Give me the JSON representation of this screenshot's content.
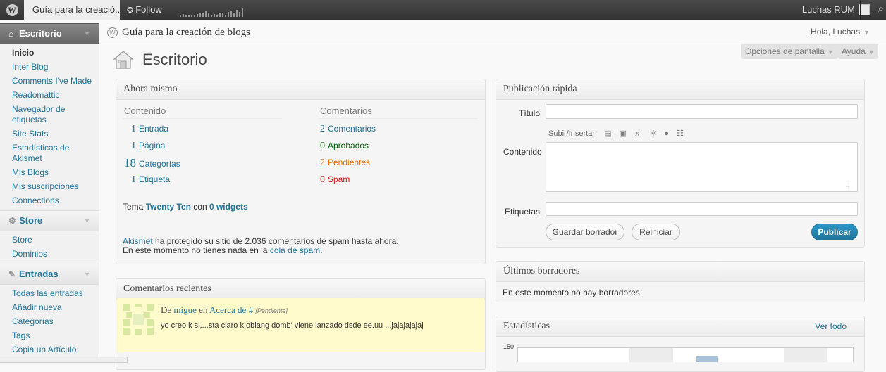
{
  "adminbar": {
    "site_title": "Guía para la creació...",
    "follow_label": "Follow",
    "user_name": "Luchas RUM"
  },
  "header": {
    "breadcrumb": "Guía para la creación de blogs",
    "greeting": "Hola, Luchas",
    "screen_options": "Opciones de pantalla",
    "help": "Ayuda",
    "page_title": "Escritorio"
  },
  "sidebar": {
    "dashboard": {
      "label": "Escritorio",
      "items": [
        "Inicio",
        "Inter Blog",
        "Comments I've Made",
        "Readomattic",
        "Navegador de etiquetas",
        "Site Stats",
        "Estadísticas de Akismet",
        "Mis Blogs",
        "Mis suscripciones",
        "Connections"
      ]
    },
    "store": {
      "label": "Store",
      "items": [
        "Store",
        "Dominios"
      ]
    },
    "posts": {
      "label": "Entradas",
      "items": [
        "Todas las entradas",
        "Añadir nueva",
        "Categorías",
        "Tags",
        "Copia un Artículo"
      ]
    }
  },
  "right_now": {
    "title": "Ahora mismo",
    "content_heading": "Contenido",
    "comments_heading": "Comentarios",
    "content_rows": [
      {
        "num": "1",
        "label": "Entrada"
      },
      {
        "num": "1",
        "label": "Página"
      },
      {
        "num": "18",
        "label": "Categorías"
      },
      {
        "num": "1",
        "label": "Etiqueta"
      }
    ],
    "comment_rows": [
      {
        "num": "2",
        "label": "Comentarios"
      },
      {
        "num": "0",
        "label": "Aprobados"
      },
      {
        "num": "2",
        "label": "Pendientes"
      },
      {
        "num": "0",
        "label": "Spam"
      }
    ],
    "theme_prefix": "Tema",
    "theme_name": "Twenty Ten",
    "theme_mid": "con",
    "widgets": "0 widgets",
    "akismet_link": "Akismet",
    "akismet_text": "ha protegido su sitio de 2.036 comentarios de spam hasta ahora.",
    "spam_queue_prefix": "En este momento no tienes nada en la",
    "spam_queue_link": "cola de spam",
    "spam_queue_suffix": "."
  },
  "recent_comments": {
    "title": "Comentarios recientes",
    "items": [
      {
        "prefix": "De",
        "author": "migue",
        "on": "en",
        "post": "Acerca de #",
        "status": "[Pendiente]",
        "excerpt": "yo creo k si,...sta claro k obiang domb' viene lanzado dsde ee.uu ...jajajajajaj"
      }
    ]
  },
  "quick_press": {
    "title": "Publicación rápida",
    "title_label": "Título",
    "upload_label": "Subir/Insertar",
    "content_label": "Contenido",
    "tags_label": "Etiquetas",
    "save_draft": "Guardar borrador",
    "reset": "Reiniciar",
    "publish": "Publicar"
  },
  "drafts": {
    "title": "Últimos borradores",
    "empty_text": "En este momento no hay borradores"
  },
  "stats": {
    "title": "Estadísticas",
    "view_all": "Ver todo",
    "y_tick_top": "150"
  },
  "colors": {
    "link": "#21759b",
    "approved": "#006505",
    "pending": "#e66f00",
    "spam": "#d41313",
    "publish_button": "#21759b"
  },
  "icons": [
    "wordpress-logo-icon",
    "home-icon",
    "store-icon",
    "pin-icon",
    "search-icon",
    "dashboard-house-icon"
  ]
}
